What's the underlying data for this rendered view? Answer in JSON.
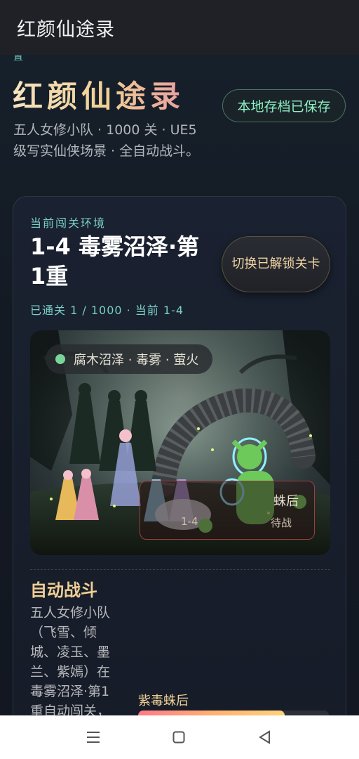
{
  "appbar": {
    "title": "红颜仙途录"
  },
  "hero": {
    "clipped_label": "置",
    "title": "红颜仙途录",
    "subtitle": "五人女修小队 · 1000 关 · UE5级写实仙侠场景 · 全自动战斗。",
    "save_button": "本地存档已保存"
  },
  "stage": {
    "env_label": "当前闯关环境",
    "title": "1-4 毒雾沼泽·第1重",
    "progress": "已通关 1 / 1000 · 当前 1-4",
    "switch_button": "切换已解锁关卡",
    "scene_tag": "腐木沼泽 · 毒雾 · 萤火",
    "enemy_hud": {
      "name_partial": "蛛后",
      "level": "1-4",
      "status": "待战"
    }
  },
  "battle": {
    "title": "自动战斗",
    "description": "五人女修小队（飞雪、倾城、凌玉、墨兰、紫嫣）在毒雾沼泽·第1重自动闯关，",
    "boss_name": "紫毒蛛后",
    "boss_hp_fraction": 0.77
  },
  "navbar": {
    "menu_icon": "menu-icon",
    "home_icon": "home-icon",
    "back_icon": "back-icon"
  },
  "colors": {
    "accent_teal": "#79cfc6",
    "accent_gold": "#f0cf95",
    "save_green": "#8ef0c2"
  }
}
